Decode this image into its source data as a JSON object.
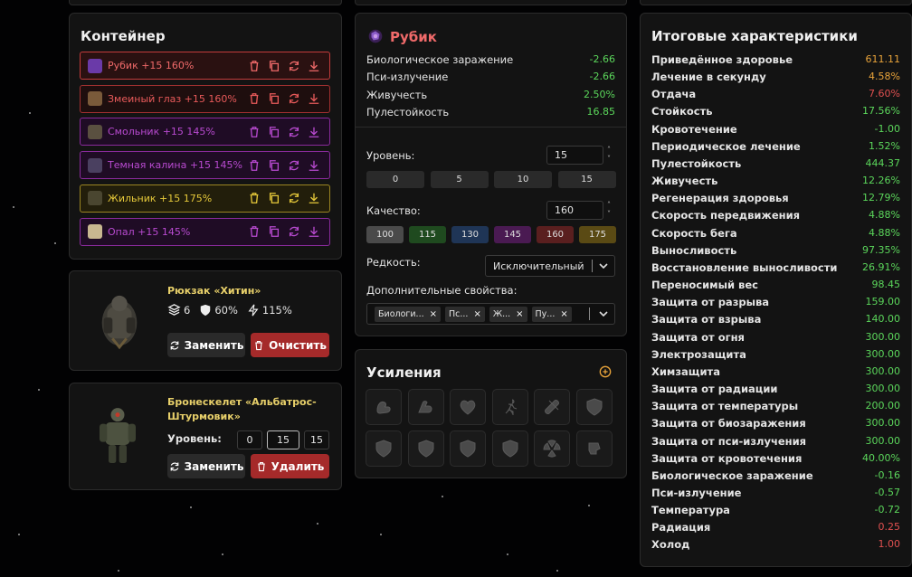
{
  "container": {
    "title": "Контейнер",
    "items": [
      {
        "label": "Рубик +15 160%",
        "icon": "ruby-artifact-icon"
      },
      {
        "label": "Змеиный глаз +15 160%",
        "icon": "snake-eye-artifact-icon"
      },
      {
        "label": "Смольник +15 145%",
        "icon": "resin-artifact-icon"
      },
      {
        "label": "Темная калина +15 145%",
        "icon": "dark-viburnum-artifact-icon"
      },
      {
        "label": "Жильник +15 175%",
        "icon": "vein-artifact-icon"
      },
      {
        "label": "Опал +15 145%",
        "icon": "opal-artifact-icon"
      }
    ]
  },
  "backpack": {
    "name": "Рюкзак «Хитин»",
    "slots": "6",
    "protection": "60%",
    "speed": "115%",
    "replace_label": "Заменить",
    "clear_label": "Очистить"
  },
  "armor": {
    "name": "Бронескелет «Альбатрос-Штурмовик»",
    "level_label": "Уровень:",
    "levels": [
      "0",
      "15",
      "15"
    ],
    "replace_label": "Заменить",
    "delete_label": "Удалить"
  },
  "artifact": {
    "title": "Рубик",
    "stats": [
      {
        "name": "Биологическое заражение",
        "value": "-2.66"
      },
      {
        "name": "Пси-излучение",
        "value": "-2.66"
      },
      {
        "name": "Живучесть",
        "value": "2.50%"
      },
      {
        "name": "Пулестойкость",
        "value": "16.85"
      }
    ],
    "level_label": "Уровень:",
    "level_value": "15",
    "level_presets": [
      "0",
      "5",
      "10",
      "15"
    ],
    "quality_label": "Качество:",
    "quality_value": "160",
    "quality_presets": [
      {
        "label": "100",
        "color": "#4a4a4a"
      },
      {
        "label": "115",
        "color": "#1f4a1f"
      },
      {
        "label": "130",
        "color": "#1f3556"
      },
      {
        "label": "145",
        "color": "#4a1a52"
      },
      {
        "label": "160",
        "color": "#5a1f1f"
      },
      {
        "label": "175",
        "color": "#5a4a14"
      }
    ],
    "rarity_label": "Редкость:",
    "rarity_value": "Исключительный",
    "extra_label": "Дополнительные свойства:",
    "extra_chips": [
      "Биологи...",
      "Пс...",
      "Ж...",
      "Пу..."
    ]
  },
  "boosters": {
    "title": "Усиления",
    "icons": [
      "strength-arm-icon",
      "flex-arm-icon",
      "heart-plus-icon",
      "runner-icon",
      "bandage-icon",
      "shield-icon",
      "thermo-shield-icon",
      "radiation-shield-icon",
      "biohazard-shield-icon",
      "psy-shield-icon",
      "radiation-minus-icon",
      "psy-minus-icon"
    ]
  },
  "summary": {
    "title": "Итоговые характеристики",
    "stats": [
      {
        "name": "Приведённое здоровье",
        "value": "611.11",
        "color": "#e8a33a"
      },
      {
        "name": "Лечение в секунду",
        "value": "4.58%",
        "color": "#e8a33a"
      },
      {
        "name": "Отдача",
        "value": "7.60%",
        "color": "#e05050"
      },
      {
        "name": "Стойкость",
        "value": "17.56%",
        "color": "#5bd65b"
      },
      {
        "name": "Кровотечение",
        "value": "-1.00",
        "color": "#5bd65b"
      },
      {
        "name": "Периодическое лечение",
        "value": "1.52%",
        "color": "#5bd65b"
      },
      {
        "name": "Пулестойкость",
        "value": "444.37",
        "color": "#5bd65b"
      },
      {
        "name": "Живучесть",
        "value": "12.26%",
        "color": "#5bd65b"
      },
      {
        "name": "Регенерация здоровья",
        "value": "12.79%",
        "color": "#5bd65b"
      },
      {
        "name": "Скорость передвижения",
        "value": "4.88%",
        "color": "#5bd65b"
      },
      {
        "name": "Скорость бега",
        "value": "4.88%",
        "color": "#5bd65b"
      },
      {
        "name": "Выносливость",
        "value": "97.35%",
        "color": "#5bd65b"
      },
      {
        "name": "Восстановление выносливости",
        "value": "26.91%",
        "color": "#5bd65b"
      },
      {
        "name": "Переносимый вес",
        "value": "98.45",
        "color": "#5bd65b"
      },
      {
        "name": "Защита от разрыва",
        "value": "159.00",
        "color": "#5bd65b"
      },
      {
        "name": "Защита от взрыва",
        "value": "140.00",
        "color": "#5bd65b"
      },
      {
        "name": "Защита от огня",
        "value": "300.00",
        "color": "#5bd65b"
      },
      {
        "name": "Электрозащита",
        "value": "300.00",
        "color": "#5bd65b"
      },
      {
        "name": "Химзащита",
        "value": "300.00",
        "color": "#5bd65b"
      },
      {
        "name": "Защита от радиации",
        "value": "300.00",
        "color": "#5bd65b"
      },
      {
        "name": "Защита от температуры",
        "value": "200.00",
        "color": "#5bd65b"
      },
      {
        "name": "Защита от биозаражения",
        "value": "300.00",
        "color": "#5bd65b"
      },
      {
        "name": "Защита от пси-излучения",
        "value": "300.00",
        "color": "#5bd65b"
      },
      {
        "name": "Защита от кровотечения",
        "value": "40.00%",
        "color": "#5bd65b"
      },
      {
        "name": "Биологическое заражение",
        "value": "-0.16",
        "color": "#5bd65b"
      },
      {
        "name": "Пси-излучение",
        "value": "-0.57",
        "color": "#5bd65b"
      },
      {
        "name": "Температура",
        "value": "-0.72",
        "color": "#5bd65b"
      },
      {
        "name": "Радиация",
        "value": "0.25",
        "color": "#e05050"
      },
      {
        "name": "Холод",
        "value": "1.00",
        "color": "#e05050"
      }
    ]
  }
}
